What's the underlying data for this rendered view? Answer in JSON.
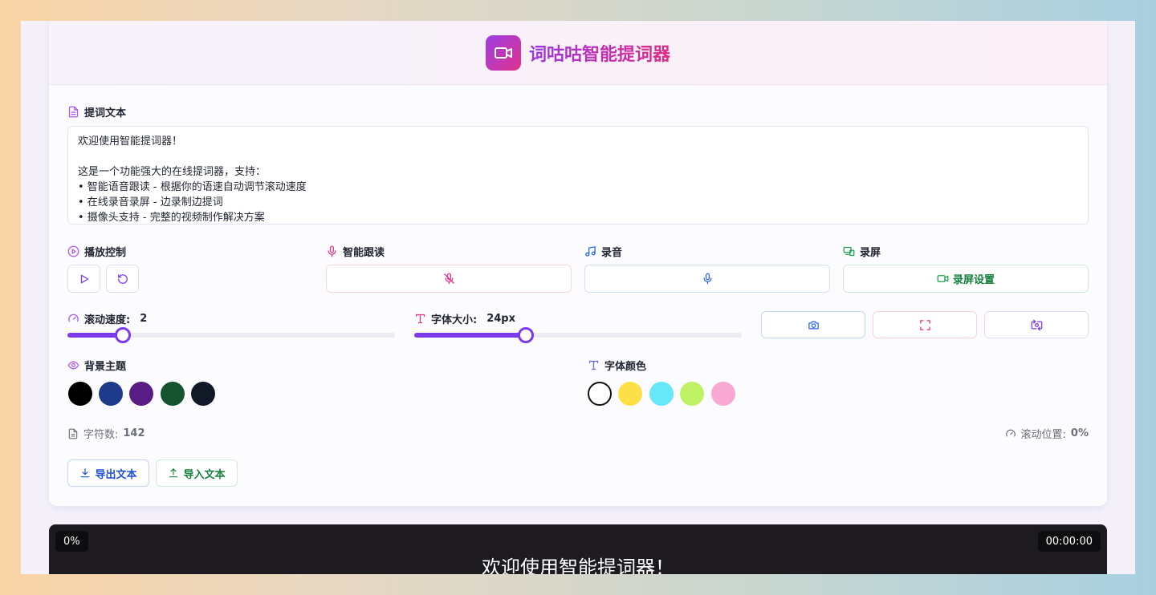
{
  "app": {
    "title": "词咕咕智能提词器"
  },
  "editor": {
    "label": "提词文本",
    "text": "欢迎使用智能提词器！\n\n这是一个功能强大的在线提词器，支持：\n• 智能语音跟读 - 根据你的语速自动调节滚动速度\n• 在线录音录屏 - 边录制边提词\n• 摄像头支持 - 完整的视频制作解决方案"
  },
  "controls": {
    "playback_label": "播放控制",
    "voice_follow_label": "智能跟读",
    "record_audio_label": "录音",
    "record_screen_label": "录屏",
    "screen_settings_button": "录屏设置"
  },
  "speed": {
    "label": "滚动速度:",
    "value": "2",
    "fraction": 0.17
  },
  "font_size": {
    "label": "字体大小:",
    "value": "24px",
    "fraction": 0.34
  },
  "background_theme": {
    "label": "背景主题",
    "colors": [
      "#000000",
      "#1e3a8a",
      "#581c87",
      "#14532d",
      "#111827"
    ]
  },
  "font_color": {
    "label": "字体颜色",
    "colors": [
      "#ffffff",
      "#fde047",
      "#67e8f9",
      "#bef264",
      "#f9a8d4"
    ],
    "selected": "#ffffff"
  },
  "stats": {
    "char_count_label": "字符数:",
    "char_count": "142",
    "scroll_position_label": "滚动位置:",
    "scroll_position": "0%"
  },
  "file_actions": {
    "export_label": "导出文本",
    "import_label": "导入文本"
  },
  "preview": {
    "progress": "0%",
    "timer": "00:00:00",
    "first_line": "欢迎使用智能提词器！"
  },
  "accent_colors": {
    "primary": "#7c3aed",
    "pink": "#e0338a",
    "blue": "#2563eb",
    "green": "#16a34a"
  }
}
